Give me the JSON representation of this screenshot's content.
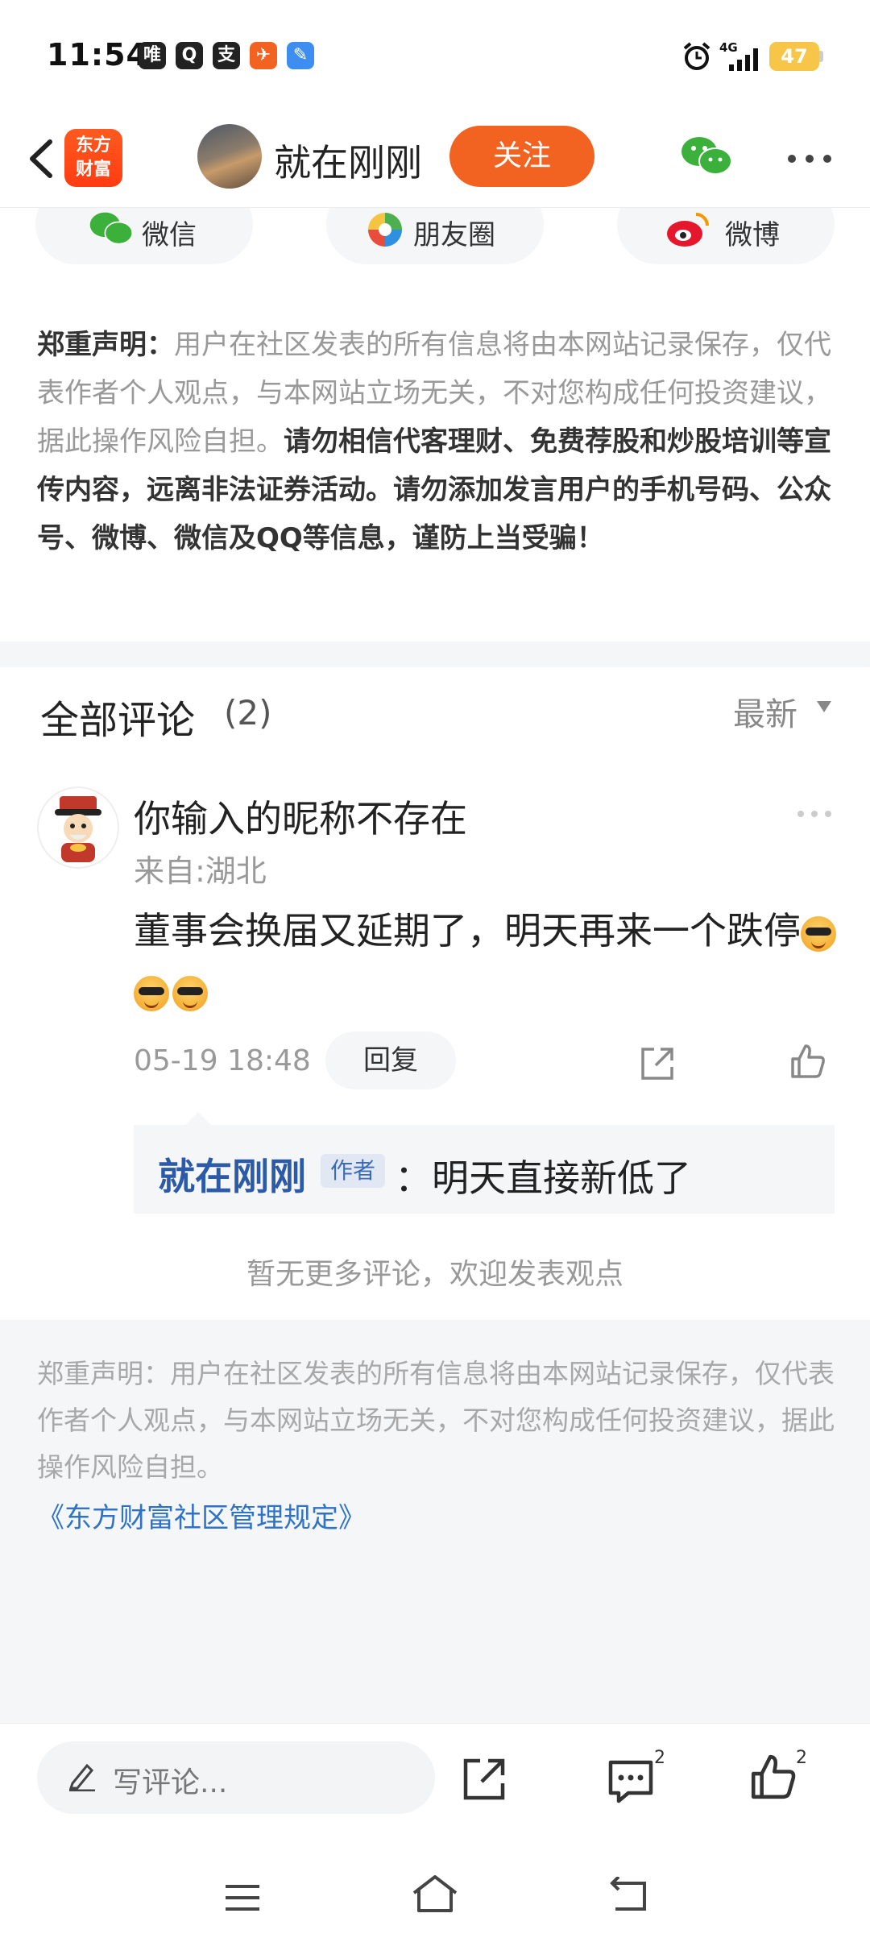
{
  "status_bar": {
    "time": "11:54",
    "app_icons": [
      "唯",
      "Q",
      "支",
      "✈",
      "✎"
    ],
    "network": "4G",
    "battery": "47"
  },
  "header": {
    "logo_line1": "东方",
    "logo_line2": "财富",
    "author_name": "就在刚刚",
    "follow_label": "关注"
  },
  "share": {
    "wechat": "微信",
    "moments": "朋友圈",
    "weibo": "微博"
  },
  "disclaimer_top": {
    "title": "郑重声明：",
    "body": "用户在社区发表的所有信息将由本网站记录保存，仅代表作者个人观点，与本网站立场无关，不对您构成任何投资建议，据此操作风险自担。",
    "warning": "请勿相信代客理财、免费荐股和炒股培训等宣传内容，远离非法证券活动。请勿添加发言用户的手机号码、公众号、微博、微信及QQ等信息，谨防上当受骗！"
  },
  "comments": {
    "title": "全部评论",
    "count": "(2)",
    "sort": "最新",
    "items": [
      {
        "user": "你输入的昵称不存在",
        "location": "来自:湖北",
        "text": "董事会换届又延期了，明天再来一个跌停",
        "time": "05-19 18:48",
        "reply_label": "回复",
        "reply": {
          "name": "就在刚刚",
          "badge": "作者",
          "text": "：明天直接新低了"
        }
      }
    ],
    "no_more": "暂无更多评论，欢迎发表观点"
  },
  "disclaimer_bottom": {
    "text": "郑重声明：用户在社区发表的所有信息将由本网站记录保存，仅代表作者个人观点，与本网站立场无关，不对您构成任何投资建议，据此操作风险自担。",
    "link": "《东方财富社区管理规定》"
  },
  "bottom_bar": {
    "placeholder": "写评论...",
    "comment_count": "2",
    "like_count": "2"
  },
  "colors": {
    "accent": "#f26322",
    "link": "#2f73c8",
    "author_name": "#2a5aa8"
  }
}
